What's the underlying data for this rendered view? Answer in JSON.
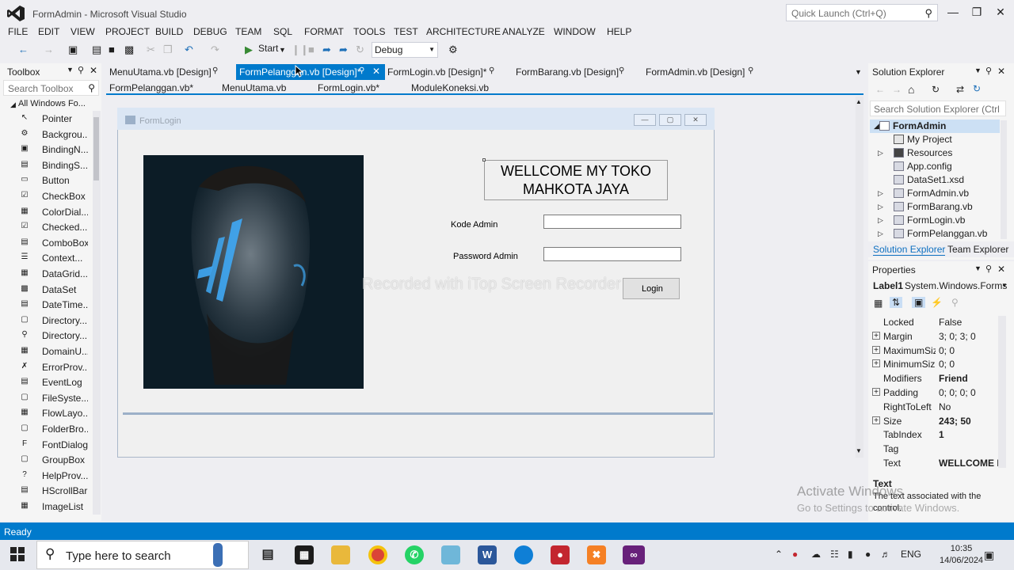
{
  "window": {
    "title": "FormAdmin - Microsoft Visual Studio",
    "quick_launch_placeholder": "Quick Launch (Ctrl+Q)"
  },
  "menu": [
    "FILE",
    "EDIT",
    "VIEW",
    "PROJECT",
    "BUILD",
    "DEBUG",
    "TEAM",
    "SQL",
    "FORMAT",
    "TOOLS",
    "TEST",
    "ARCHITECTURE",
    "ANALYZE",
    "WINDOW",
    "HELP"
  ],
  "toolbar": {
    "start_label": "Start",
    "configuration": "Debug"
  },
  "toolbox": {
    "title": "Toolbox",
    "search_placeholder": "Search Toolbox",
    "group": "All Windows Fo...",
    "items": [
      "Pointer",
      "Backgrou...",
      "BindingN...",
      "BindingS...",
      "Button",
      "CheckBox",
      "ColorDial...",
      "Checked...",
      "ComboBox",
      "Context...",
      "DataGrid...",
      "DataSet",
      "DateTime...",
      "Directory...",
      "Directory...",
      "DomainU...",
      "ErrorProv...",
      "EventLog",
      "FileSyste...",
      "FlowLayo...",
      "FolderBro...",
      "FontDialog",
      "GroupBox",
      "HelpProv...",
      "HScrollBar",
      "ImageList"
    ]
  },
  "tabs": {
    "main": [
      "MenuUtama.vb [Design]",
      "FormPelanggan.vb [Design]*",
      "FormLogin.vb [Design]*",
      "FormBarang.vb [Design]",
      "FormAdmin.vb [Design]"
    ],
    "active_index": 1,
    "sub": [
      "FormPelanggan.vb*",
      "MenuUtama.vb",
      "FormLogin.vb*",
      "ModuleKoneksi.vb"
    ]
  },
  "form": {
    "title": "FormLogin",
    "heading_line1": "WELLCOME MY TOKO",
    "heading_line2": "MAHKOTA JAYA",
    "label_kode": "Kode Admin",
    "label_password": "Password Admin",
    "login_button": "Login",
    "watermark": "Recorded with iTop Screen Recorder"
  },
  "solution_explorer": {
    "title": "Solution Explorer",
    "search_placeholder": "Search Solution Explorer (Ctrl",
    "items": [
      {
        "label": "FormAdmin",
        "bold": true
      },
      {
        "label": "My Project"
      },
      {
        "label": "Resources"
      },
      {
        "label": "App.config"
      },
      {
        "label": "DataSet1.xsd"
      },
      {
        "label": "FormAdmin.vb"
      },
      {
        "label": "FormBarang.vb"
      },
      {
        "label": "FormLogin.vb"
      },
      {
        "label": "FormPelanggan.vb"
      }
    ],
    "tab_solution": "Solution Explorer",
    "tab_team": "Team Explorer"
  },
  "properties": {
    "title": "Properties",
    "object_name": "Label1",
    "object_type": "System.Windows.Forms",
    "rows": [
      {
        "name": "Locked",
        "value": "False"
      },
      {
        "name": "Margin",
        "value": "3; 0; 3; 0"
      },
      {
        "name": "MaximumSiz",
        "value": "0; 0"
      },
      {
        "name": "MinimumSiz",
        "value": "0; 0"
      },
      {
        "name": "Modifiers",
        "value": "Friend"
      },
      {
        "name": "Padding",
        "value": "0; 0; 0; 0"
      },
      {
        "name": "RightToLeft",
        "value": "No"
      },
      {
        "name": "Size",
        "value": "243; 50"
      },
      {
        "name": "TabIndex",
        "value": "1"
      },
      {
        "name": "Tag",
        "value": ""
      },
      {
        "name": "Text",
        "value": "WELLCOME M"
      }
    ],
    "desc_title": "Text",
    "desc_text1": "The text associated with the",
    "desc_text2": "control."
  },
  "activation": {
    "line1": "Activate Windows",
    "line2": "Go to Settings to activate Windows."
  },
  "status": {
    "text": "Ready"
  },
  "taskbar": {
    "search_placeholder": "Type here to search",
    "language": "ENG",
    "time": "10:35",
    "date": "14/06/2024"
  }
}
